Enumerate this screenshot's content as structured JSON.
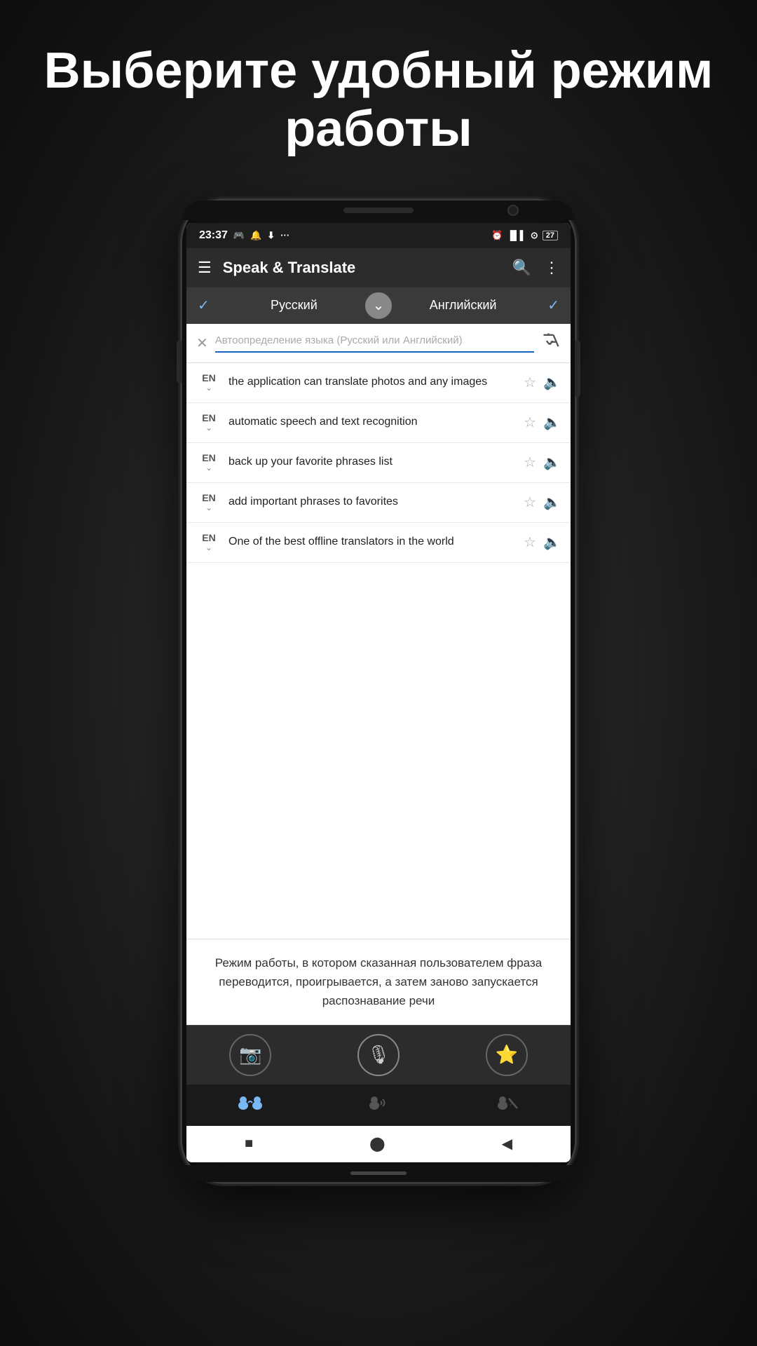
{
  "page": {
    "title_line1": "Выберите удобный режим",
    "title_line2": "работы"
  },
  "status_bar": {
    "time": "23:37",
    "right_icons": "⏰ ▐▌▌ ⊙ 27"
  },
  "toolbar": {
    "title": "Speak & Translate"
  },
  "language_bar": {
    "left_lang": "Русский",
    "right_lang": "Английский",
    "swap_icon": "⌄"
  },
  "search": {
    "placeholder": "Автоопределение языка (Русский или Английский)"
  },
  "items": [
    {
      "lang": "EN",
      "text": "the application can translate photos and any images"
    },
    {
      "lang": "EN",
      "text": "automatic speech and text recognition"
    },
    {
      "lang": "EN",
      "text": "back up your favorite phrases list"
    },
    {
      "lang": "EN",
      "text": "add important phrases to favorites"
    },
    {
      "lang": "EN",
      "text": "One of the best offline translators in the world"
    }
  ],
  "translation_output": "Режим работы, в котором сказанная пользователем фраза переводится, проигрывается, а затем заново запускается распознавание речи",
  "modes": [
    {
      "label": "conversation",
      "active": true
    },
    {
      "label": "audio",
      "active": false
    },
    {
      "label": "silent",
      "active": false
    }
  ]
}
